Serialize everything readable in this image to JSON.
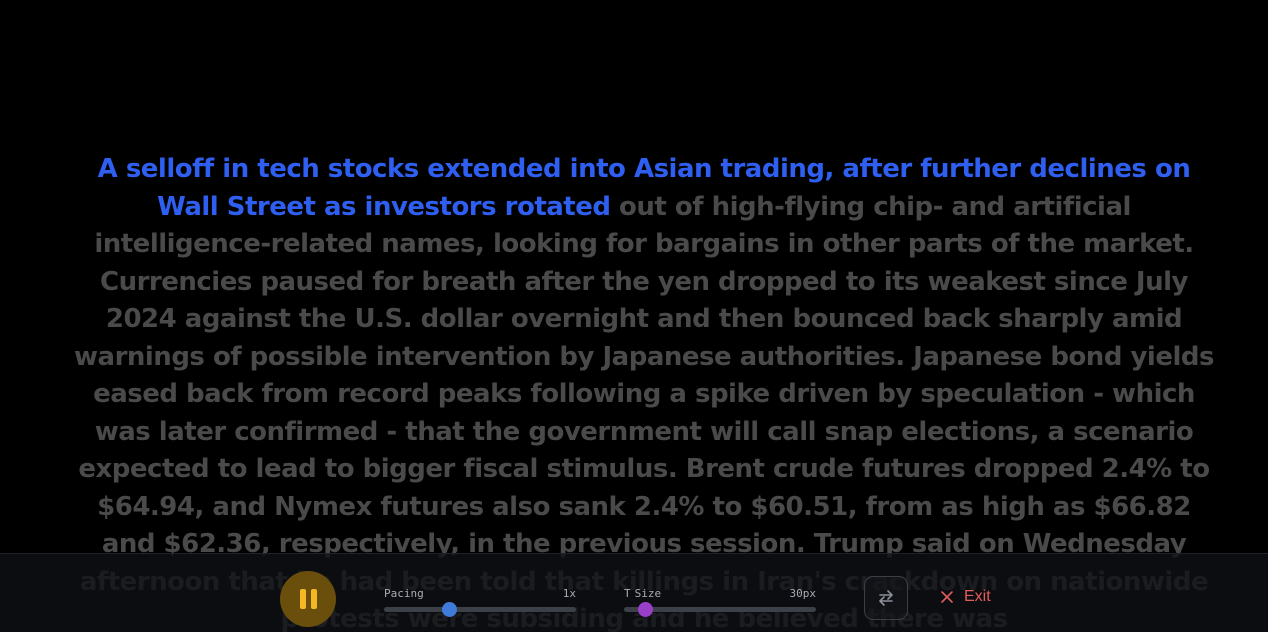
{
  "reader": {
    "read_text": "A selloff in tech stocks extended into Asian trading, after further declines on Wall Street as investors rotated",
    "unread_text": " out of high-flying chip- and artificial intelligence-related names, looking for bargains in other parts of the market. Currencies paused for breath after the yen dropped to its weakest since July 2024 against the U.S. dollar overnight and then bounced back sharply amid warnings of possible intervention by Japanese authorities. Japanese bond yields eased back from record peaks following a spike driven by speculation - which was later confirmed - that the government will call snap elections, a scenario expected to lead to bigger fiscal stimulus. Brent crude futures dropped 2.4% to $64.94, and Nymex futures also sank 2.4% to $60.51, from as high as $66.82 and $62.36, respectively, in the previous session. Trump said on Wednesday afternoon that he had been told that killings in Iran's crackdown on nationwide protests were subsiding and he believed there was",
    "highlight_color": "#2e5ff0",
    "text_color": "#4a4a4a"
  },
  "controls": {
    "play_state": "playing",
    "play_icon": "pause-icon",
    "pacing": {
      "label": "Pacing",
      "value_label": "1x",
      "level": 0.34
    },
    "size": {
      "icon": "T",
      "label": "Size",
      "value_label": "30px",
      "level": 0.11
    },
    "swap_icon": "swap-arrows-icon",
    "exit": {
      "label": "Exit",
      "icon": "close-x-icon",
      "color": "#e25c5c"
    },
    "accent_pause": "#f4b822",
    "accent_pacing": "#3f7bd9",
    "accent_size": "#9a3fc8"
  }
}
